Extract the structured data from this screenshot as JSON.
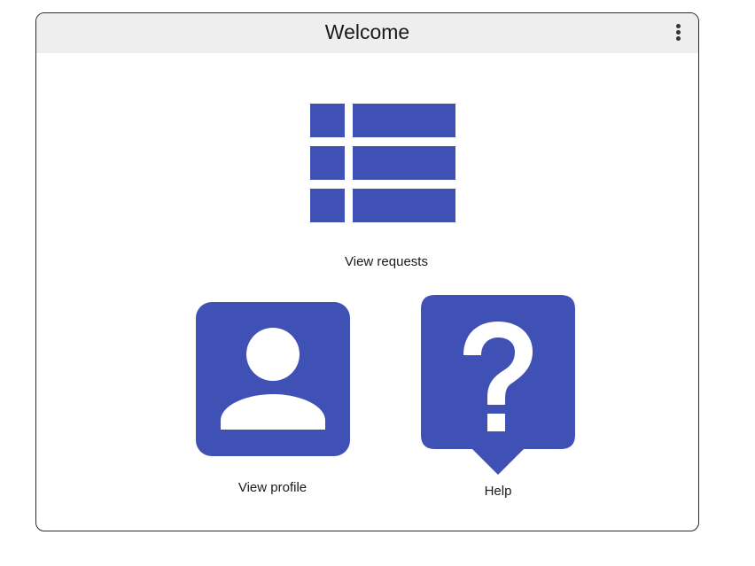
{
  "header": {
    "title": "Welcome",
    "menu_icon": "more-vert-icon"
  },
  "tiles": {
    "requests": {
      "label": "View requests",
      "icon": "list-table-icon"
    },
    "profile": {
      "label": "View profile",
      "icon": "account-box-icon"
    },
    "help": {
      "label": "Help",
      "icon": "help-speech-bubble-icon"
    }
  },
  "colors": {
    "accent": "#3f51b5",
    "titlebar_bg": "#eeeeee",
    "border": "#2b2b2b"
  }
}
